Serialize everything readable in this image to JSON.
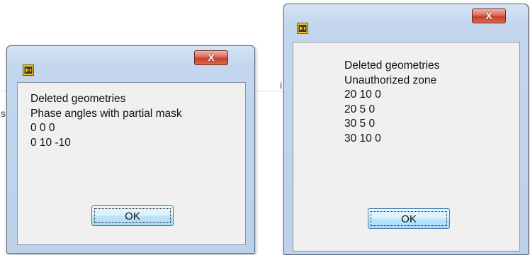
{
  "dialogs": [
    {
      "close_label": "X",
      "lines": [
        "Deleted geometries",
        "Phase angles with partial mask",
        "0 0 0",
        "0 10 -10"
      ],
      "ok_label": "OK"
    },
    {
      "close_label": "X",
      "lines": [
        "Deleted geometries",
        "Unauthorized zone",
        "20 10 0",
        "20 5 0",
        "30 5 0",
        "30 10 0"
      ],
      "ok_label": "OK"
    }
  ],
  "icons": {
    "app": "labview-vi-icon",
    "close": "close-icon"
  },
  "colors": {
    "frame": "#c3d6ee",
    "close_button": "#c6402a",
    "ok_button": "#bee6fd",
    "client_area": "#f0f0f0"
  },
  "background": {
    "fragment_left": "s",
    "fragment_right": "i"
  }
}
